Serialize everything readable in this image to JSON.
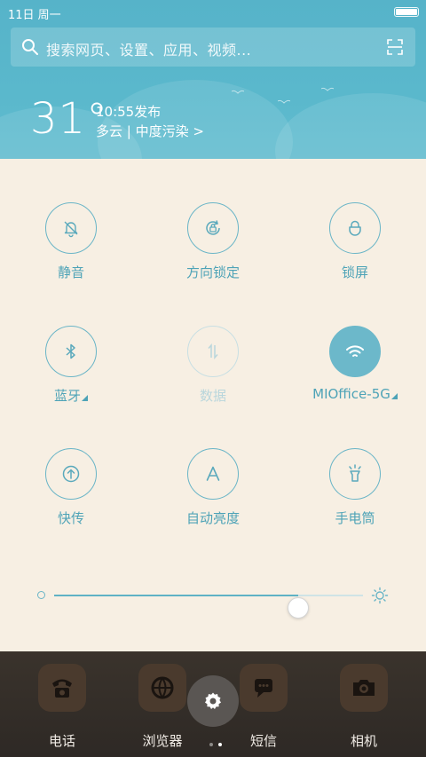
{
  "status_bar": {
    "date": "11日 周一",
    "battery_level": 1.0
  },
  "search": {
    "placeholder": "搜索网页、设置、应用、视频..."
  },
  "weather": {
    "temperature": "31°",
    "time": "10:55发布",
    "description": "多云 | 中度污染 >"
  },
  "toggles": [
    {
      "label": "静音",
      "icon": "bell-off-icon",
      "state": "off"
    },
    {
      "label": "方向锁定",
      "icon": "rotation-lock-icon",
      "state": "off"
    },
    {
      "label": "锁屏",
      "icon": "lock-icon",
      "state": "off"
    },
    {
      "label": "蓝牙",
      "icon": "bluetooth-icon",
      "state": "off",
      "has_menu": true
    },
    {
      "label": "数据",
      "icon": "mobile-data-icon",
      "state": "disabled"
    },
    {
      "label": "MIOffice-5G",
      "icon": "wifi-icon",
      "state": "on",
      "has_menu": true
    },
    {
      "label": "快传",
      "icon": "transfer-icon",
      "state": "off"
    },
    {
      "label": "自动亮度",
      "icon": "auto-brightness-icon",
      "state": "off"
    },
    {
      "label": "手电筒",
      "icon": "flashlight-icon",
      "state": "off"
    }
  ],
  "brightness": {
    "level": 0.79
  },
  "dock": {
    "apps": [
      {
        "label": "电话",
        "icon": "phone-icon"
      },
      {
        "label": "浏览器",
        "icon": "browser-icon"
      },
      {
        "label": "短信",
        "icon": "sms-icon"
      },
      {
        "label": "相机",
        "icon": "camera-icon"
      }
    ],
    "page_count": 2,
    "active_page": 2
  },
  "colors": {
    "accent": "#5fb2c5",
    "panel_bg": "#f7efe3",
    "header_bg": "#5ab8cc"
  }
}
